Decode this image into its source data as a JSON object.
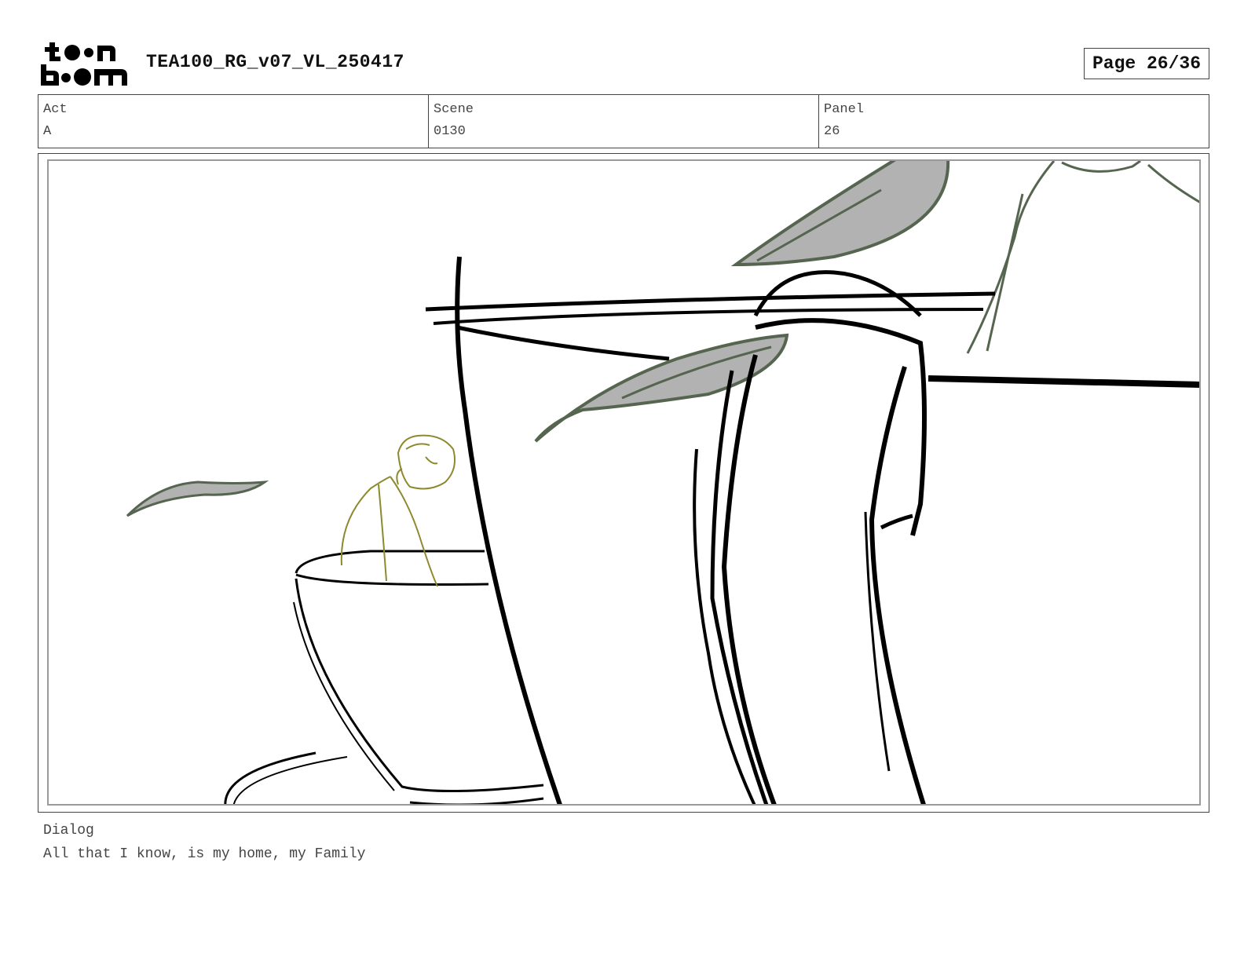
{
  "header": {
    "logo_name": "toon boom logo",
    "title": "TEA100_RG_v07_VL_250417",
    "page": "Page 26/36"
  },
  "meta": {
    "act": {
      "label": "Act",
      "value": "A"
    },
    "scene": {
      "label": "Scene",
      "value": "0130"
    },
    "panel": {
      "label": "Panel",
      "value": "26"
    }
  },
  "dialog": {
    "label": "Dialog",
    "text": "All that I know, is my home, my Family"
  },
  "colors": {
    "leaf_stroke": "#56654f",
    "leaf_fill": "#b2b2b2",
    "character_stroke": "#8c8a2c",
    "ink": "#000000"
  }
}
